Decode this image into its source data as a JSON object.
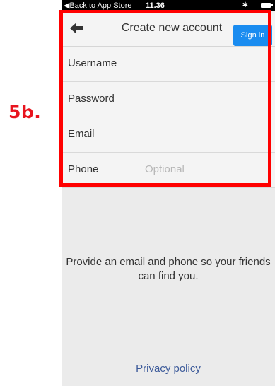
{
  "annotation": {
    "label": "5b."
  },
  "statusbar": {
    "back_text": "◀Back to App Store",
    "time": "11.36",
    "bluetooth_icon": "bluetooth-icon",
    "battery_icon": "battery-icon"
  },
  "header": {
    "back_icon": "back-arrow-icon",
    "title": "Create new account",
    "signin_label": "Sign in",
    "signin_color": "#1a8cf0"
  },
  "form": {
    "fields": [
      {
        "label": "Username",
        "placeholder": ""
      },
      {
        "label": "Password",
        "placeholder": ""
      },
      {
        "label": "Email",
        "placeholder": ""
      },
      {
        "label": "Phone",
        "placeholder": "Optional"
      }
    ]
  },
  "info_text": "Provide an email and phone so your friends can find you.",
  "privacy_link": "Privacy policy",
  "colors": {
    "annotation_red": "#ff0000",
    "link_blue": "#3c5a9a",
    "background": "#ebebeb"
  }
}
